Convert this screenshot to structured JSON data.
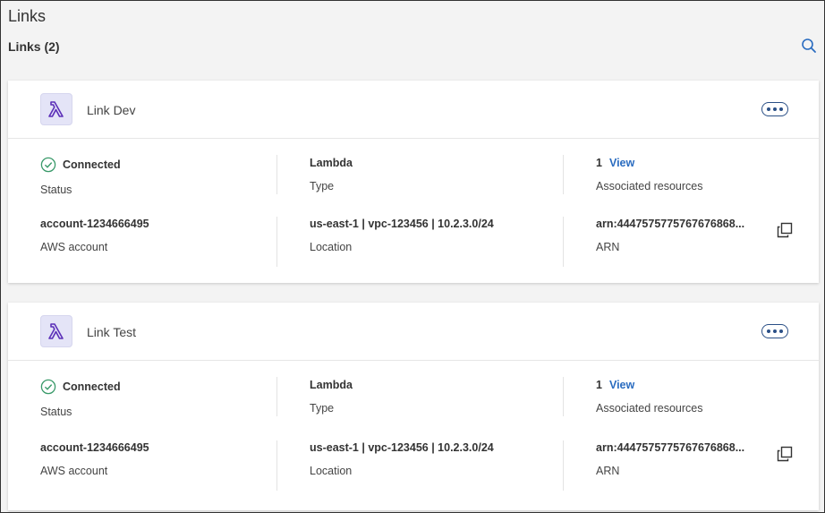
{
  "page": {
    "title": "Links",
    "section_header": "Links (2)"
  },
  "links": [
    {
      "name": "Link Dev",
      "status": "Connected",
      "status_label": "Status",
      "type": "Lambda",
      "type_label": "Type",
      "associated_count": "1",
      "view_label": "View",
      "associated_label": "Associated resources",
      "aws_account": "account-1234666495",
      "aws_account_label": "AWS account",
      "location": "us-east-1 | vpc-123456 | 10.2.3.0/24",
      "location_label": "Location",
      "arn": "arn:4447575775767676868...",
      "arn_label": "ARN"
    },
    {
      "name": "Link Test",
      "status": "Connected",
      "status_label": "Status",
      "type": "Lambda",
      "type_label": "Type",
      "associated_count": "1",
      "view_label": "View",
      "associated_label": "Associated resources",
      "aws_account": "account-1234666495",
      "aws_account_label": "AWS account",
      "location": "us-east-1 | vpc-123456 | 10.2.3.0/24",
      "location_label": "Location",
      "arn": "arn:4447575775767676868...",
      "arn_label": "ARN"
    }
  ],
  "icons": {
    "search": "search-icon",
    "lambda": "lambda-icon",
    "more": "more-options-icon",
    "status": "check-circle-icon",
    "copy": "copy-icon"
  },
  "colors": {
    "accent": "#2a6cc0",
    "status_ok": "#3a9a6a",
    "lambda": "#5b2fb8",
    "more_button": "#2a4f86"
  }
}
